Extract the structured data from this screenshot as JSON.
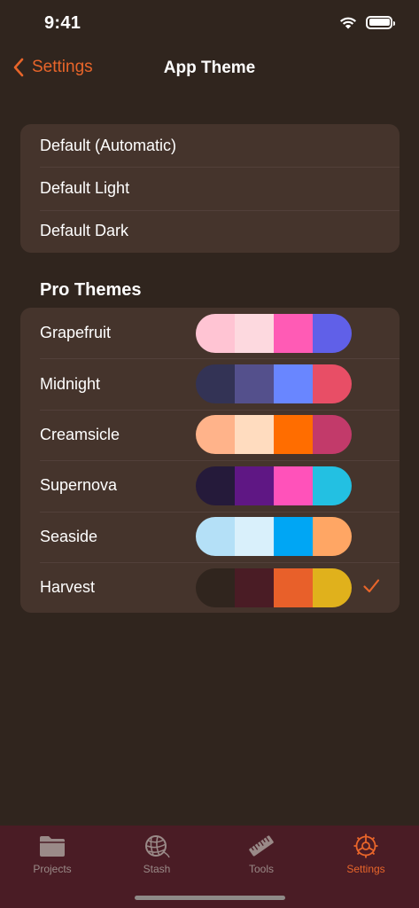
{
  "status_bar": {
    "time": "9:41"
  },
  "nav": {
    "back_label": "Settings",
    "title": "App Theme"
  },
  "default_themes": [
    {
      "label": "Default (Automatic)"
    },
    {
      "label": "Default Light"
    },
    {
      "label": "Default Dark"
    }
  ],
  "pro_section_title": "Pro Themes",
  "pro_themes": [
    {
      "label": "Grapefruit",
      "colors": [
        "#ffc4d3",
        "#fdd9df",
        "#ff5bb5",
        "#6060e8"
      ],
      "selected": false
    },
    {
      "label": "Midnight",
      "colors": [
        "#333355",
        "#54508c",
        "#6986ff",
        "#e84e66"
      ],
      "selected": false
    },
    {
      "label": "Creamsicle",
      "colors": [
        "#ffb38a",
        "#ffdcbf",
        "#ff6d00",
        "#c23a6a"
      ],
      "selected": false
    },
    {
      "label": "Supernova",
      "colors": [
        "#251a3a",
        "#5f1784",
        "#ff52ba",
        "#23c0e2"
      ],
      "selected": false
    },
    {
      "label": "Seaside",
      "colors": [
        "#b4e0f7",
        "#d9f0fb",
        "#00a6f4",
        "#ffa664"
      ],
      "selected": false
    },
    {
      "label": "Harvest",
      "colors": [
        "#30251e",
        "#4a1c25",
        "#e8602a",
        "#e0b11c"
      ],
      "selected": true
    }
  ],
  "tabs": [
    {
      "label": "Projects",
      "icon": "folder-icon",
      "active": false
    },
    {
      "label": "Stash",
      "icon": "yarn-ball-icon",
      "active": false
    },
    {
      "label": "Tools",
      "icon": "ruler-icon",
      "active": false
    },
    {
      "label": "Settings",
      "icon": "gear-icon",
      "active": true
    }
  ],
  "colors": {
    "accent": "#e8652a",
    "background": "#30251e",
    "card": "#45342c",
    "tab_bar": "#4a1c25"
  }
}
